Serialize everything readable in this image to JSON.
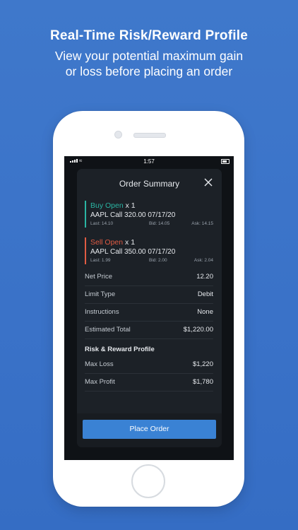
{
  "promo": {
    "headline": "Real-Time Risk/Reward Profile",
    "subline_1": "View your potential maximum gain",
    "subline_2": "or loss before placing an order"
  },
  "status_bar": {
    "time": "1:57"
  },
  "order_summary": {
    "title": "Order Summary",
    "legs": [
      {
        "action": "Buy Open",
        "qty": "x 1",
        "contract": "AAPL Call 320.00  07/17/20",
        "last": "Last: 14.10",
        "bid": "Bid: 14.05",
        "ask": "Ask: 14.15",
        "color": "#2ab5a3"
      },
      {
        "action": "Sell Open",
        "qty": "x 1",
        "contract": "AAPL Call 350.00  07/17/20",
        "last": "Last: 1.99",
        "bid": "Bid: 2.00",
        "ask": "Ask: 2.04",
        "color": "#e05b43"
      }
    ],
    "details": [
      {
        "label": "Net Price",
        "value": "12.20"
      },
      {
        "label": "Limit Type",
        "value": "Debit"
      },
      {
        "label": "Instructions",
        "value": "None"
      },
      {
        "label": "Estimated Total",
        "value": "$1,220.00"
      }
    ],
    "risk_section_title": "Risk & Reward Profile",
    "risk": [
      {
        "label": "Max Loss",
        "value": "$1,220"
      },
      {
        "label": "Max Profit",
        "value": "$1,780"
      }
    ],
    "place_order_label": "Place Order"
  },
  "colors": {
    "background": "#3a72c8",
    "accent_button": "#3a82d4",
    "buy": "#2ab5a3",
    "sell": "#e05b43"
  }
}
